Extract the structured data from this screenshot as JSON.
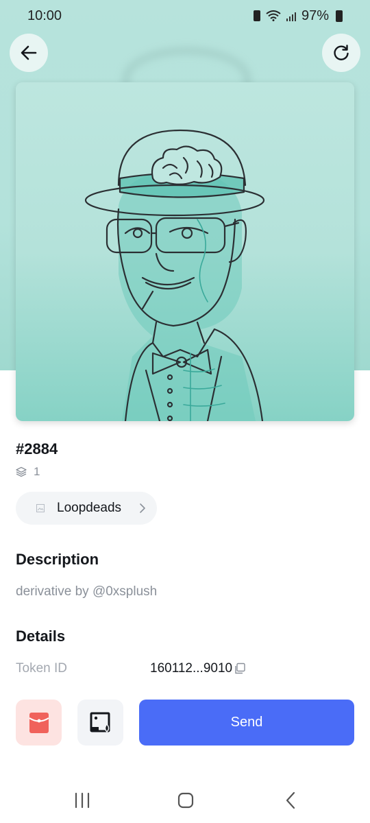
{
  "status_bar": {
    "time": "10:00",
    "battery_percent": "97%",
    "icons": [
      "battery-saver-icon",
      "wifi-icon",
      "signal-icon",
      "battery-icon"
    ]
  },
  "header": {
    "back_icon": "arrow-left-icon",
    "refresh_icon": "refresh-icon"
  },
  "nft": {
    "token_title": "#2884",
    "quantity": "1",
    "quantity_icon": "layers-icon",
    "collection": {
      "name": "Loopdeads",
      "icon": "image-placeholder-icon",
      "chevron": "chevron-right-icon"
    }
  },
  "description": {
    "heading": "Description",
    "text": "derivative by @0xsplush"
  },
  "details": {
    "heading": "Details",
    "rows": [
      {
        "label": "Token ID",
        "value": "160112...9010",
        "icon": "copy-icon"
      }
    ]
  },
  "actions": {
    "redpacket_icon": "red-packet-icon",
    "image_icon": "image-upload-icon",
    "send_label": "Send"
  },
  "colors": {
    "accent": "#4a6cf7",
    "nft_bg": "#b4e2da",
    "redpacket_bg": "#fde3e1",
    "redpacket": "#f0625b"
  },
  "nav_bar": {
    "icons": [
      "recent-apps-icon",
      "home-icon",
      "back-icon"
    ]
  }
}
